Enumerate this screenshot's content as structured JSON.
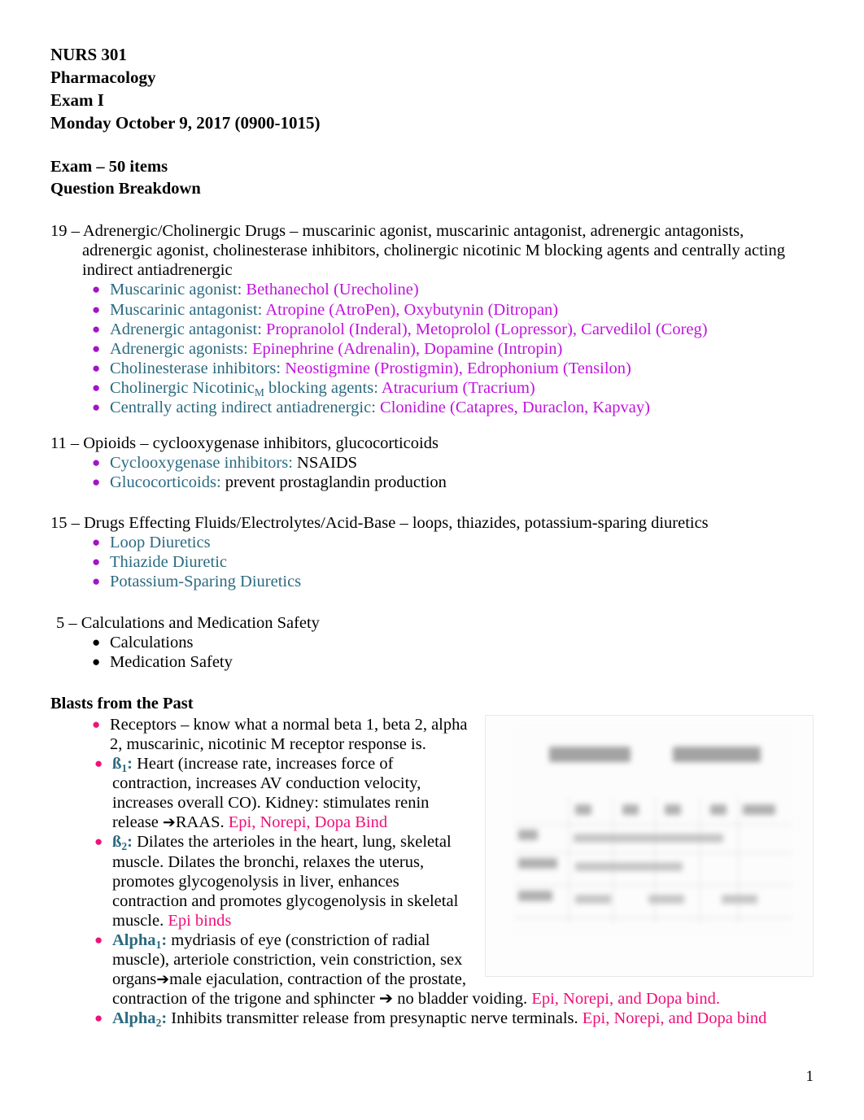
{
  "document": {
    "header": {
      "lines": [
        "NURS 301",
        "Pharmacology",
        "Exam I",
        "Monday October 9, 2017 (0900-1015)"
      ]
    },
    "subheader": {
      "line1": "Exam – 50 items",
      "line2": "Question Breakdown"
    },
    "sections": [
      {
        "id": "adrenergic-cholinergic",
        "lead": "19 – Adrenergic/Cholinergic Drugs – muscarinic agonist, muscarinic antagonist, adrenergic antagonists, adrenergic agonist, cholinesterase inhibitors, cholinergic nicotinic M blocking agents and centrally acting indirect antiadrenergic",
        "bullet_color": "purple",
        "items": [
          {
            "label": "Muscarinic agonist:",
            "value": "Bethanechol (Urecholine)",
            "label_color": "teal",
            "value_color": "magenta"
          },
          {
            "label": "Muscarinic antagonist:",
            "value": "Atropine (AtroPen), Oxybutynin (Ditropan)",
            "label_color": "teal",
            "value_color": "magenta"
          },
          {
            "label": "Adrenergic antagonist:",
            "value": "Propranolol (Inderal), Metoprolol (Lopressor), Carvedilol (Coreg)",
            "label_color": "teal",
            "value_color": "magenta"
          },
          {
            "label": "Adrenergic agonists:",
            "value": "Epinephrine (Adrenalin), Dopamine (Intropin)",
            "label_color": "teal",
            "value_color": "magenta"
          },
          {
            "label": "Cholinesterase inhibitors:",
            "value": "Neostigmine (Prostigmin), Edrophonium (Tensilon)",
            "label_color": "teal",
            "value_color": "magenta"
          },
          {
            "label_pre": "Cholinergic Nicotinic",
            "label_sub": "M",
            "label_post": " blocking agents:",
            "value": "Atracurium (Tracrium)",
            "label_color": "teal",
            "value_color": "magenta"
          },
          {
            "label": "Centrally acting indirect antiadrenergic:",
            "value": "Clonidine (Catapres, Duraclon, Kapvay)",
            "label_color": "teal",
            "value_color": "magenta"
          }
        ]
      },
      {
        "id": "opioids",
        "lead": "11 – Opioids – cyclooxygenase inhibitors, glucocorticoids",
        "bullet_color": "purple",
        "items": [
          {
            "label": "Cyclooxygenase inhibitors:",
            "value": "NSAIDS",
            "label_color": "teal",
            "value_color": "black"
          },
          {
            "label": "Glucocorticoids:",
            "value": "prevent prostaglandin production",
            "label_color": "teal",
            "value_color": "black"
          }
        ]
      },
      {
        "id": "fluids-electrolytes",
        "lead": "15 – Drugs Effecting Fluids/Electrolytes/Acid-Base – loops, thiazides, potassium-sparing diuretics",
        "bullet_color": "purple",
        "items": [
          {
            "label": "Loop Diuretics",
            "value": "",
            "label_color": "teal",
            "value_color": "teal"
          },
          {
            "label": "Thiazide Diuretic",
            "value": "",
            "label_color": "teal",
            "value_color": "teal"
          },
          {
            "label": "Potassium-Sparing Diuretics",
            "value": "",
            "label_color": "teal",
            "value_color": "teal"
          }
        ]
      },
      {
        "id": "calculations",
        "lead": "5 – Calculations and Medication Safety",
        "bullet_color": "black",
        "items": [
          {
            "label": "Calculations",
            "value": "",
            "label_color": "black",
            "value_color": "black"
          },
          {
            "label": "Medication Safety",
            "value": "",
            "label_color": "black",
            "value_color": "black"
          }
        ]
      }
    ],
    "blasts": {
      "heading": "Blasts from the Past",
      "intro": "Receptors – know what a normal beta 1, beta 2, alpha 2, muscarinic, nicotinic M receptor response is.",
      "receptors": [
        {
          "name_pre": "ß",
          "name_sub": "1",
          "name_post": ":",
          "body_a": " Heart (increase rate, increases force of contraction, increases AV conduction velocity, increases overall CO). Kidney: stimulates renin release ",
          "arrow": "➔",
          "body_b": "RAAS. ",
          "binding": "Epi, Norepi, Dopa Bind"
        },
        {
          "name_pre": "ß",
          "name_sub": "2",
          "name_post": ":",
          "body_a": " Dilates the arterioles in the heart, lung, skeletal muscle. Dilates the bronchi, relaxes the uterus, promotes glycogenolysis in liver, enhances contraction and promotes glycogenolysis in skeletal muscle. ",
          "arrow": "",
          "body_b": "",
          "binding": "Epi binds"
        },
        {
          "name_pre": "Alpha",
          "name_sub": "1",
          "name_post": ":",
          "body_a": " mydriasis of eye (constriction of radial muscle), arteriole constriction, vein constriction, sex organs",
          "arrow": "➔",
          "body_b": "male ejaculation, contraction of the prostate, contraction of the trigone and sphincter ➔ no bladder voiding. ",
          "binding": "Epi, Norepi, and Dopa bind."
        },
        {
          "name_pre": "Alpha",
          "name_sub": "2",
          "name_post": ":",
          "body_a": " Inhibits transmitter release from presynaptic nerve terminals. ",
          "arrow": "",
          "body_b": "",
          "binding": "Epi, Norepi, and Dopa bind"
        }
      ]
    },
    "embedded_image": {
      "alt_title": "Receptor Specificity",
      "description": "blurred receptor specificity table screenshot"
    },
    "page_number": "1",
    "colors": {
      "teal": "#2B6A80",
      "magenta": "#C013DE",
      "pink": "#EE1079",
      "bullet_purple": "#A313C8",
      "bullet_pink": "#EC137A",
      "black": "#000000"
    }
  }
}
